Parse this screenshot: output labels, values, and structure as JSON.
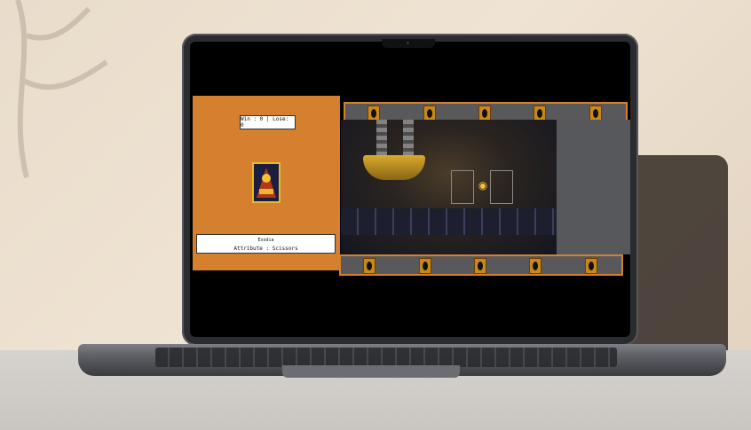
{
  "game": {
    "score_text": "Win : 0 | Lose: 0",
    "selected_card": {
      "name": "Exodia",
      "attribute_text": "Attribute : Scissors"
    },
    "opponent_hand_count": 5,
    "player_hand_count": 5,
    "colors": {
      "panel": "#d4802f",
      "row": "#59595c",
      "card_back": "#c8891a"
    }
  }
}
